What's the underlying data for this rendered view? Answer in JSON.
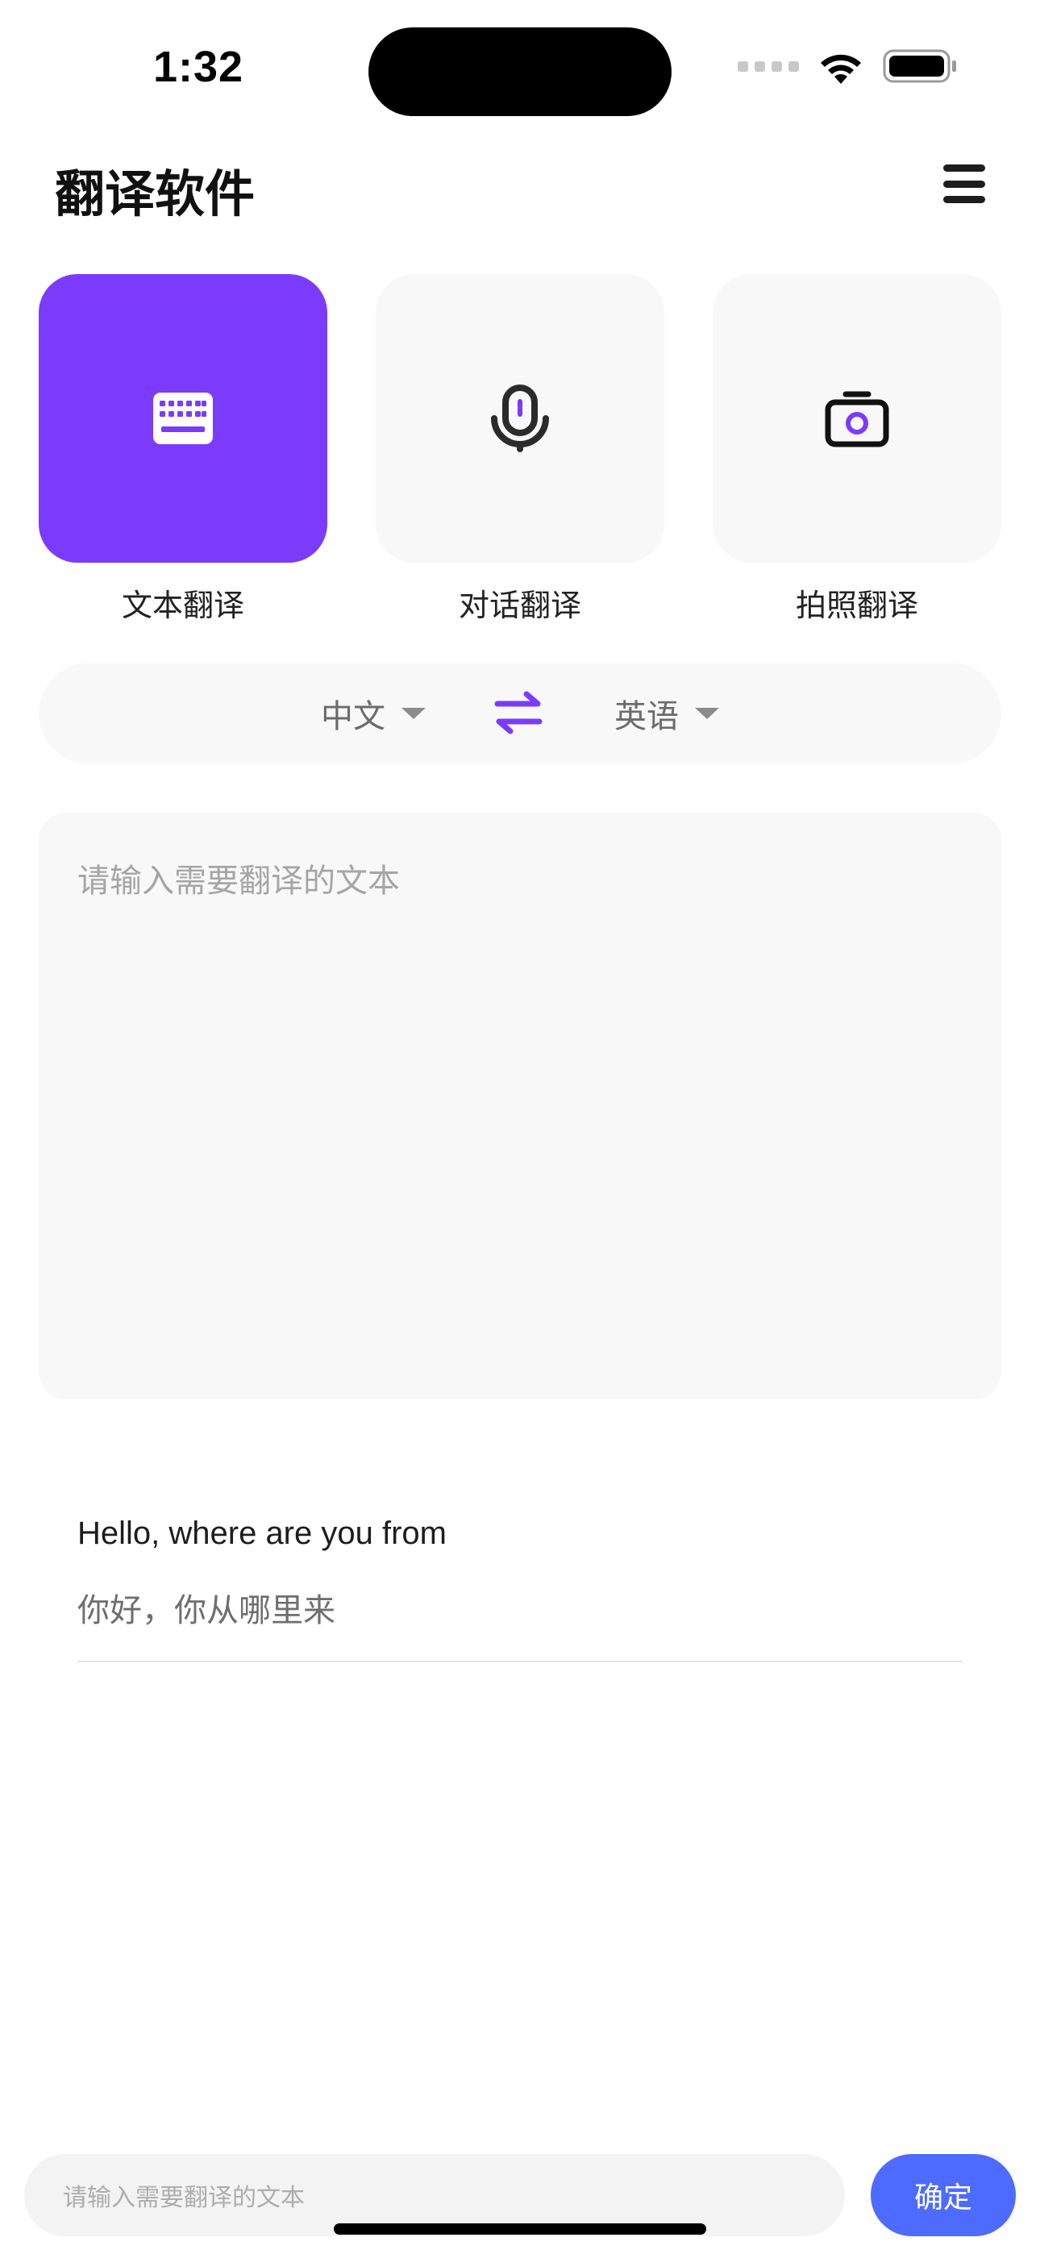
{
  "status_bar": {
    "time": "1:32",
    "icons": [
      "cellular-signal-icon",
      "wifi-icon",
      "battery-icon"
    ]
  },
  "header": {
    "title": "翻译软件",
    "menu_icon": "hamburger-menu-icon"
  },
  "modes": [
    {
      "label": "文本翻译",
      "icon": "keyboard-icon",
      "active": true
    },
    {
      "label": "对话翻译",
      "icon": "microphone-icon",
      "active": false
    },
    {
      "label": "拍照翻译",
      "icon": "camera-icon",
      "active": false
    }
  ],
  "language": {
    "from": "中文",
    "to": "英语",
    "swap_icon": "swap-arrows-icon"
  },
  "input": {
    "placeholder": "请输入需要翻译的文本"
  },
  "results": [
    {
      "source": "Hello, where are you from",
      "translation": "你好，你从哪里来"
    }
  ],
  "bottom_bar": {
    "placeholder": "请输入需要翻译的文本",
    "confirm_label": "确定"
  },
  "colors": {
    "accent": "#7b3bfb",
    "confirm": "#4d6bff",
    "tile_bg": "#f8f8f8"
  }
}
